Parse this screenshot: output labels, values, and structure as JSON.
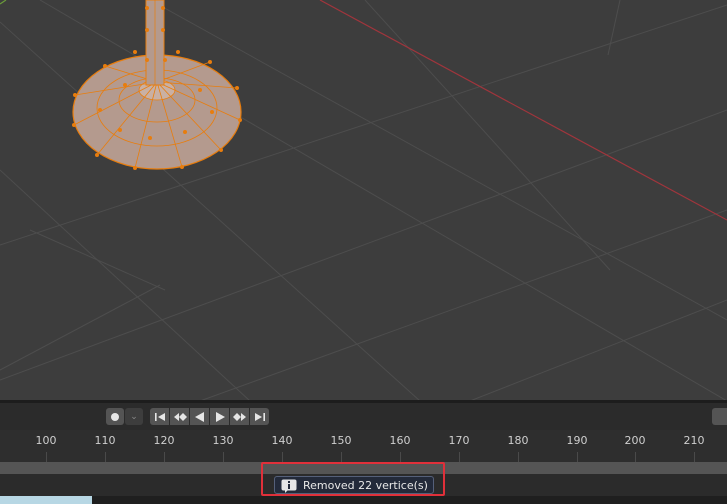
{
  "viewport": {
    "object": "vase-mesh-edit-mode"
  },
  "playback": {
    "record_icon": "record-dot-icon",
    "keying_dropdown_icon": "chevron-down-icon",
    "transport_icons": [
      "jump-to-start-icon",
      "jump-to-keyframe-prev-icon",
      "play-reverse-icon",
      "play-icon",
      "jump-to-keyframe-next-icon",
      "jump-to-end-icon"
    ]
  },
  "timeline": {
    "ticks": [
      "100",
      "110",
      "120",
      "130",
      "140",
      "150",
      "160",
      "170",
      "180",
      "190",
      "200",
      "210"
    ]
  },
  "report": {
    "icon": "info-icon",
    "text": "Removed 22 vertice(s)"
  },
  "colors": {
    "mesh_selected": "#e87d0d",
    "x_axis": "#a0353c",
    "highlight": "#e0303a"
  }
}
